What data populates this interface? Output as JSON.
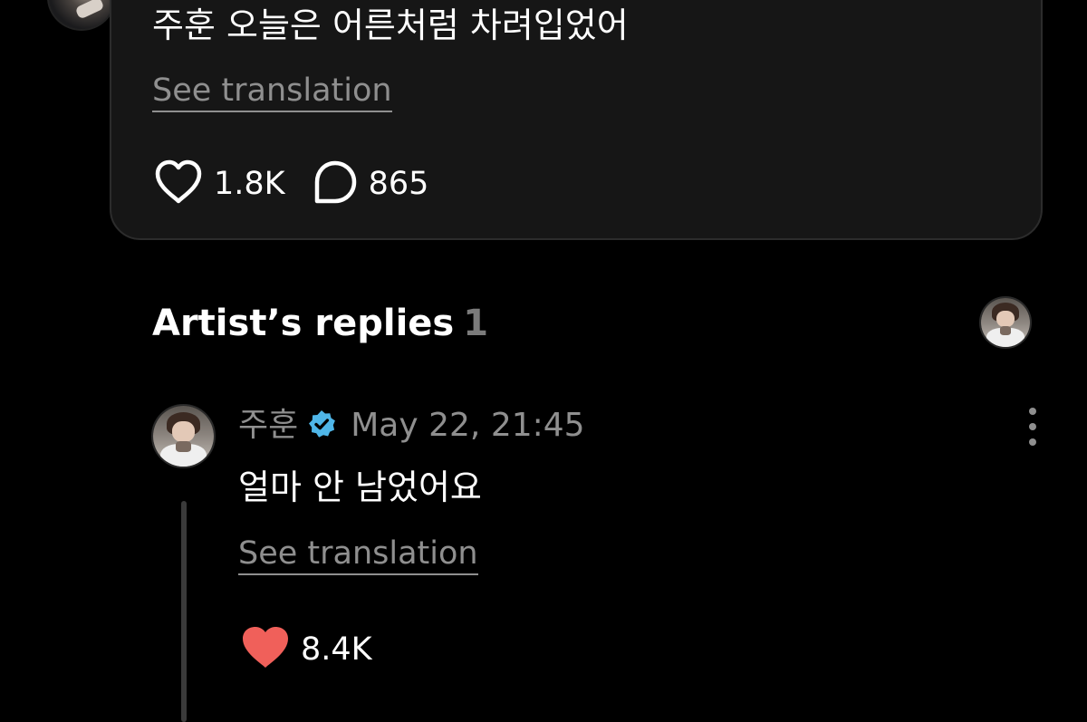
{
  "post": {
    "text": "주훈 오늘은 어른처럼 차려입었어",
    "translate_label": "See translation",
    "likes": "1.8K",
    "comments": "865"
  },
  "replies": {
    "title": "Artist’s replies",
    "count": "1"
  },
  "reply": {
    "author": "주훈",
    "timestamp": "May 22, 21:45",
    "text": "얼마 안 남었어요",
    "translate_label": "See translation",
    "likes": "8.4K"
  },
  "colors": {
    "background": "#000000",
    "card": "#161616",
    "muted_text": "#8f8f8f",
    "liked_heart": "#f0605a",
    "verified_badge": "#4fb6e8"
  },
  "icons": {
    "post_like": "heart-outline-icon",
    "post_comment": "comment-bubble-icon",
    "verified": "verified-badge-icon",
    "reply_like": "heart-filled-icon",
    "more": "more-vertical-icon"
  }
}
